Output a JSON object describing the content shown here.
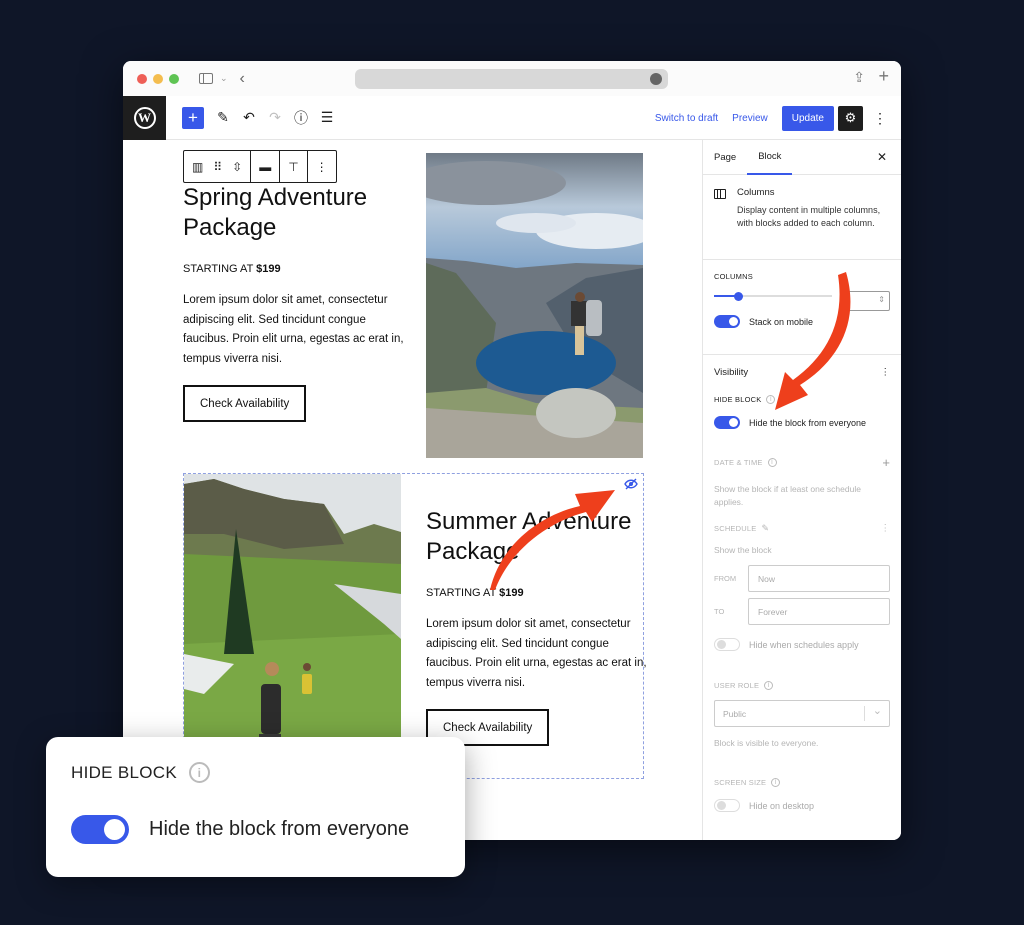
{
  "browser": {
    "traffic_lights": [
      "#ee5f57",
      "#f4bd4f",
      "#5fc454"
    ],
    "url": ""
  },
  "toolbar": {
    "logo": "W",
    "add_icon": "+",
    "switch_to_draft": "Switch to draft",
    "preview": "Preview",
    "update": "Update",
    "accent": "#3858e9"
  },
  "canvas": {
    "block1": {
      "heading": "Spring Adventure Package",
      "price_prefix": "STARTING AT ",
      "price": "$199",
      "body": "Lorem ipsum dolor sit amet, consectetur adipiscing elit. Sed tincidunt congue faucibus. Proin elit urna, egestas ac erat in, tempus viverra nisi.",
      "button": "Check Availability",
      "image_alt": "Hiker overlooking a mountain lake"
    },
    "block2": {
      "heading": "Summer Adventure Package",
      "price_prefix": "STARTING AT ",
      "price": "$199",
      "body": "Lorem ipsum dolor sit amet, consectetur adipiscing elit. Sed tincidunt congue faucibus. Proin elit urna, egestas ac erat in, tempus viverra nisi.",
      "button": "Check Availability",
      "image_alt": "Hikers on a green alpine slope",
      "hidden_indicator": "eye-off"
    }
  },
  "sidebar": {
    "tabs": [
      "Page",
      "Block"
    ],
    "active_tab": "Block",
    "block_card": {
      "title": "Columns",
      "description": "Display content in multiple columns, with blocks added to each column."
    },
    "columns": {
      "label": "COLUMNS",
      "slider_fraction": 0.2,
      "stack_on_mobile_label": "Stack on mobile",
      "stack_on_mobile": true
    },
    "visibility": {
      "title": "Visibility",
      "hide_block_label": "HIDE BLOCK",
      "hide_block_toggle_label": "Hide the block from everyone",
      "hide_block": true,
      "date_time_label": "DATE & TIME",
      "date_time_help": "Show the block if at least one schedule applies.",
      "schedule_label": "SCHEDULE",
      "schedule_help": "Show the block",
      "from_label": "FROM",
      "from_value": "Now",
      "to_label": "TO",
      "to_value": "Forever",
      "hide_when_schedules_label": "Hide when schedules apply",
      "hide_when_schedules": false,
      "user_role_label": "USER ROLE",
      "user_role_value": "Public",
      "user_role_help": "Block is visible to everyone.",
      "screen_size_label": "SCREEN SIZE",
      "hide_on_desktop_label": "Hide on desktop",
      "hide_on_desktop": false
    }
  },
  "callout": {
    "title": "HIDE BLOCK",
    "toggle_label": "Hide the block from everyone",
    "toggle_on": true
  },
  "annotation_color": "#ee3f1c"
}
